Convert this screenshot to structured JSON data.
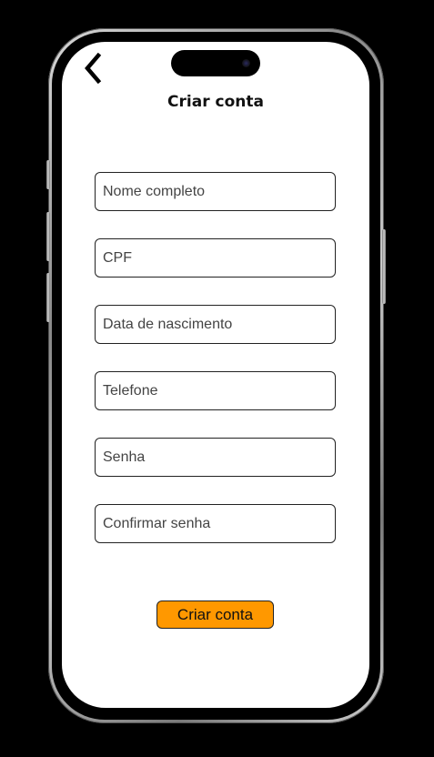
{
  "header": {
    "title": "Criar conta",
    "back_icon": "chevron-left-icon"
  },
  "form": {
    "fields": [
      {
        "placeholder": "Nome completo",
        "value": ""
      },
      {
        "placeholder": "CPF",
        "value": ""
      },
      {
        "placeholder": "Data de nascimento",
        "value": ""
      },
      {
        "placeholder": "Telefone",
        "value": ""
      },
      {
        "placeholder": "Senha",
        "value": ""
      },
      {
        "placeholder": "Confirmar senha",
        "value": ""
      }
    ],
    "submit_label": "Criar conta"
  },
  "colors": {
    "accent": "#ff9800",
    "background": "#ffffff",
    "device_background": "#000000"
  }
}
